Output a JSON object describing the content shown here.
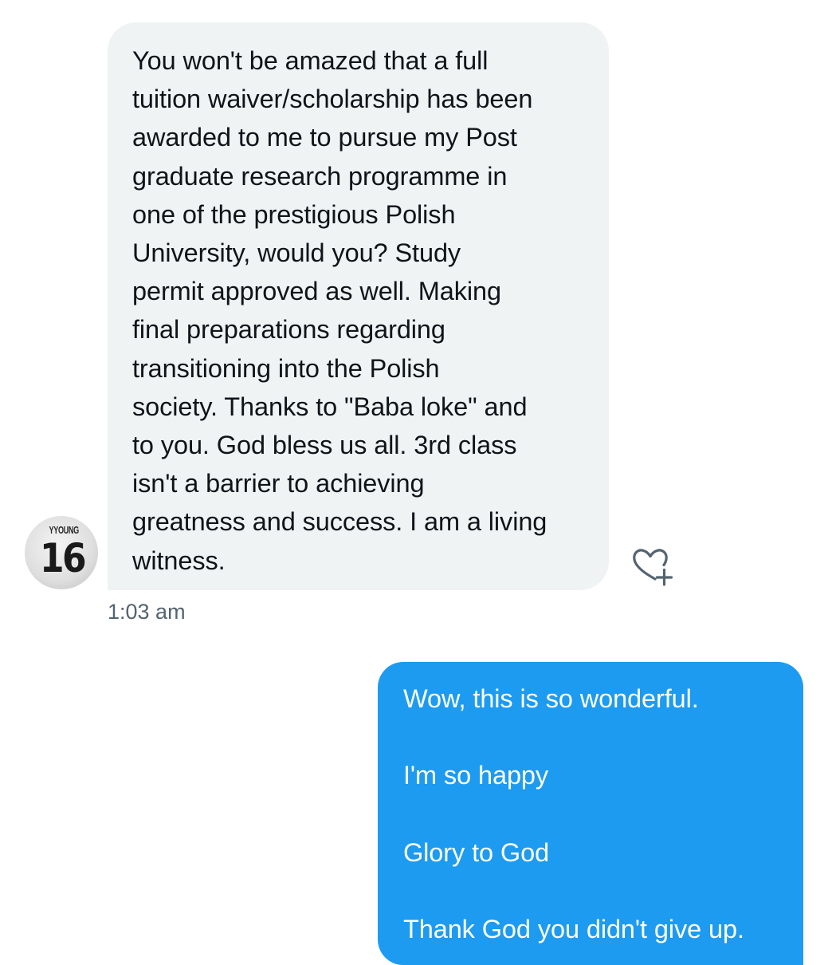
{
  "messages": {
    "incoming": {
      "text": "You won't be amazed that a full\ntuition waiver/scholarship has been\nawarded to me to pursue my Post\ngraduate research programme in\none of the prestigious Polish\nUniversity, would you? Study\npermit approved as well. Making\nfinal preparations regarding\ntransitioning into the Polish\nsociety. Thanks to \"Baba loke\" and\nto you. God bless us all. 3rd class\nisn't a barrier to achieving\ngreatness and success. I am a living\nwitness.",
      "timestamp": "1:03 am",
      "avatar": {
        "name": "YYOUNG",
        "number": "16"
      },
      "react_icon": "heart-plus-icon"
    },
    "outgoing": {
      "text": "Wow, this is so wonderful.\n\nI'm so happy\n\nGlory to God\n\nThank God you didn't give up."
    }
  },
  "colors": {
    "incoming_bubble": "#eff3f4",
    "outgoing_bubble": "#1d9bf0",
    "timestamp": "#536471",
    "text_dark": "#0f1419"
  }
}
